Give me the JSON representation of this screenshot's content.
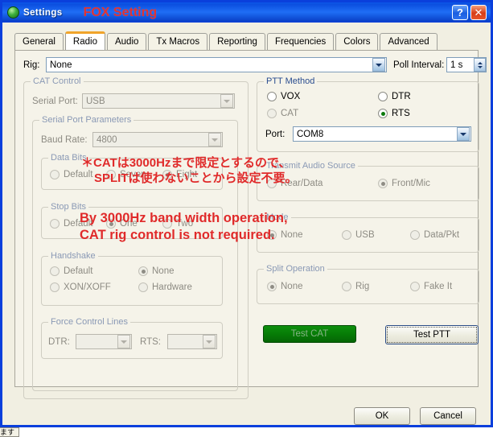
{
  "window": {
    "title": "Settings",
    "annotation_title": "FOX Setting",
    "icon": "globe-icon",
    "help_button": "?",
    "close_button": "✕",
    "accent_blue": "#0a3fdc",
    "annotation_red": "#e02a2a"
  },
  "tabs": [
    {
      "label": "General",
      "mnemonic": "l",
      "active": false
    },
    {
      "label": "Radio",
      "mnemonic": "R",
      "active": true
    },
    {
      "label": "Audio",
      "mnemonic": "u",
      "active": false
    },
    {
      "label": "Tx Macros",
      "mnemonic": "M",
      "active": false
    },
    {
      "label": "Reporting",
      "mnemonic": "",
      "active": false
    },
    {
      "label": "Frequencies",
      "mnemonic": "",
      "active": false
    },
    {
      "label": "Colors",
      "mnemonic": "",
      "active": false
    },
    {
      "label": "Advanced",
      "mnemonic": "",
      "active": false
    }
  ],
  "rig": {
    "label": "Rig:",
    "value": "None"
  },
  "poll_interval": {
    "label": "Poll Interval:",
    "value": "1 s"
  },
  "cat_control": {
    "title": "CAT Control",
    "serial_port": {
      "label": "Serial Port:",
      "value": "USB",
      "enabled": false
    },
    "serial_port_parameters": {
      "title": "Serial Port Parameters",
      "baud_rate": {
        "label": "Baud Rate:",
        "value": "4800",
        "enabled": false
      },
      "data_bits": {
        "title": "Data Bits",
        "options": [
          "Default",
          "Seven",
          "Eight"
        ],
        "selected": "Eight"
      },
      "stop_bits": {
        "title": "Stop Bits",
        "options": [
          "Default",
          "One",
          "Two"
        ],
        "selected": "One"
      },
      "handshake": {
        "title": "Handshake",
        "options": [
          "Default",
          "XON/XOFF",
          "None",
          "Hardware"
        ],
        "selected": "None"
      },
      "force_control_lines": {
        "title": "Force Control Lines",
        "dtr": {
          "label": "DTR:",
          "value": ""
        },
        "rts": {
          "label": "RTS:",
          "value": ""
        }
      }
    }
  },
  "ptt_method": {
    "title": "PTT Method",
    "options": [
      "VOX",
      "CAT",
      "DTR",
      "RTS"
    ],
    "selected": "RTS",
    "disabled_options": [
      "CAT"
    ],
    "port": {
      "label": "Port:",
      "value": "COM8"
    }
  },
  "transmit_audio_source": {
    "title": "Transmit Audio Source",
    "options": [
      "Rear/Data",
      "Front/Mic"
    ],
    "selected": "Front/Mic"
  },
  "mode": {
    "title": "Mode",
    "options": [
      "None",
      "USB",
      "Data/Pkt"
    ],
    "selected": "None"
  },
  "split_operation": {
    "title": "Split Operation",
    "options": [
      "None",
      "Rig",
      "Fake It"
    ],
    "selected": "None"
  },
  "test_buttons": {
    "test_cat": "Test CAT",
    "test_ptt": "Test PTT",
    "test_cat_color": "#067a06"
  },
  "dialog_buttons": {
    "ok": "OK",
    "cancel": "Cancel"
  },
  "annotations": {
    "japanese_line1": "＊CATは3000Hzまで限定とするので、",
    "japanese_line2": "SPLITは使わないことから設定不要。",
    "english_line1": "By 3000Hz band width operation,",
    "english_line2": "CAT rig control is not required."
  },
  "taskbar_fragment": "ます"
}
